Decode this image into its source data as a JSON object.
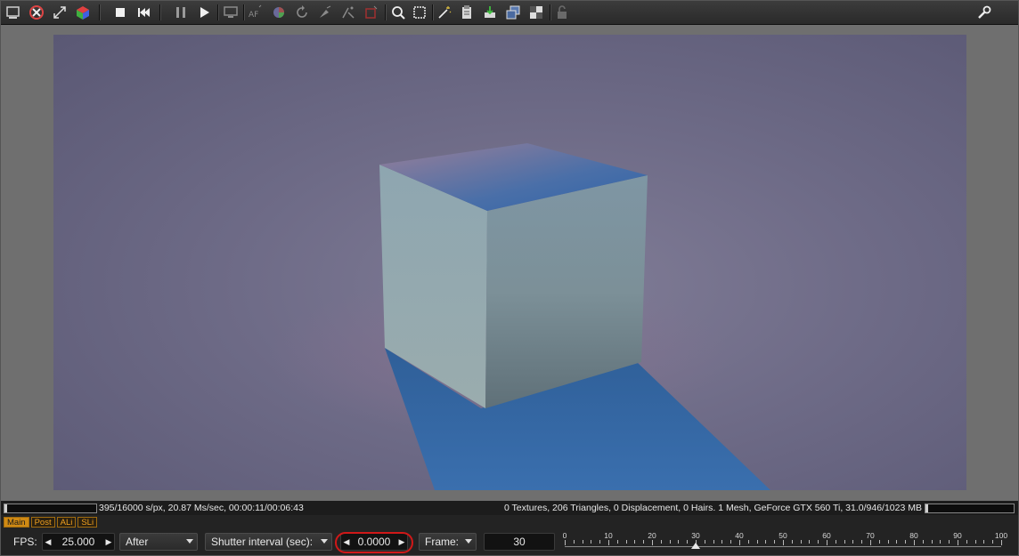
{
  "toolbar": {
    "icons": [
      "viewport-icon",
      "stop-render-icon",
      "fit-icon",
      "cube-icon",
      "stop-icon",
      "rewind-icon",
      "pause-icon",
      "play-icon",
      "monitor-icon",
      "af-icon",
      "color-wheel-icon",
      "refresh-icon",
      "picker-icon",
      "region-icon",
      "region-red-icon",
      "zoom-icon",
      "crop-icon",
      "wand-icon",
      "clipboard-icon",
      "export-icon",
      "layers-icon",
      "texture-icon",
      "lock-icon",
      "wrench-icon"
    ]
  },
  "status": {
    "left": "395/16000 s/px, 20.87 Ms/sec, 00:00:11/00:06:43",
    "right": "0 Textures, 206 Triangles, 0 Displacement, 0 Hairs. 1 Mesh, GeForce GTX 560 Ti, 31.0/946/1023 MB",
    "progress": 0.025
  },
  "tabs": [
    {
      "label": "Main",
      "active": true
    },
    {
      "label": "Post",
      "active": false
    },
    {
      "label": "ALi",
      "active": false
    },
    {
      "label": "SLi",
      "active": false
    }
  ],
  "controls": {
    "fps_label": "FPS:",
    "fps_value": "25.000",
    "blend_mode": "After",
    "shutter_label": "Shutter interval (sec):",
    "shutter_value": "0.0000",
    "frame_label": "Frame:",
    "frame_value": "30"
  },
  "timeline": {
    "ticks": [
      "0",
      "10",
      "20",
      "30",
      "40",
      "50",
      "60",
      "70",
      "80",
      "90",
      "100"
    ],
    "min": 0,
    "max": 100,
    "current": 30
  },
  "colors": {
    "accent": "#d08a14",
    "highlight_ring": "#d01818",
    "render_bg": "#6e6b87",
    "shadow": "#2f6aa8"
  }
}
